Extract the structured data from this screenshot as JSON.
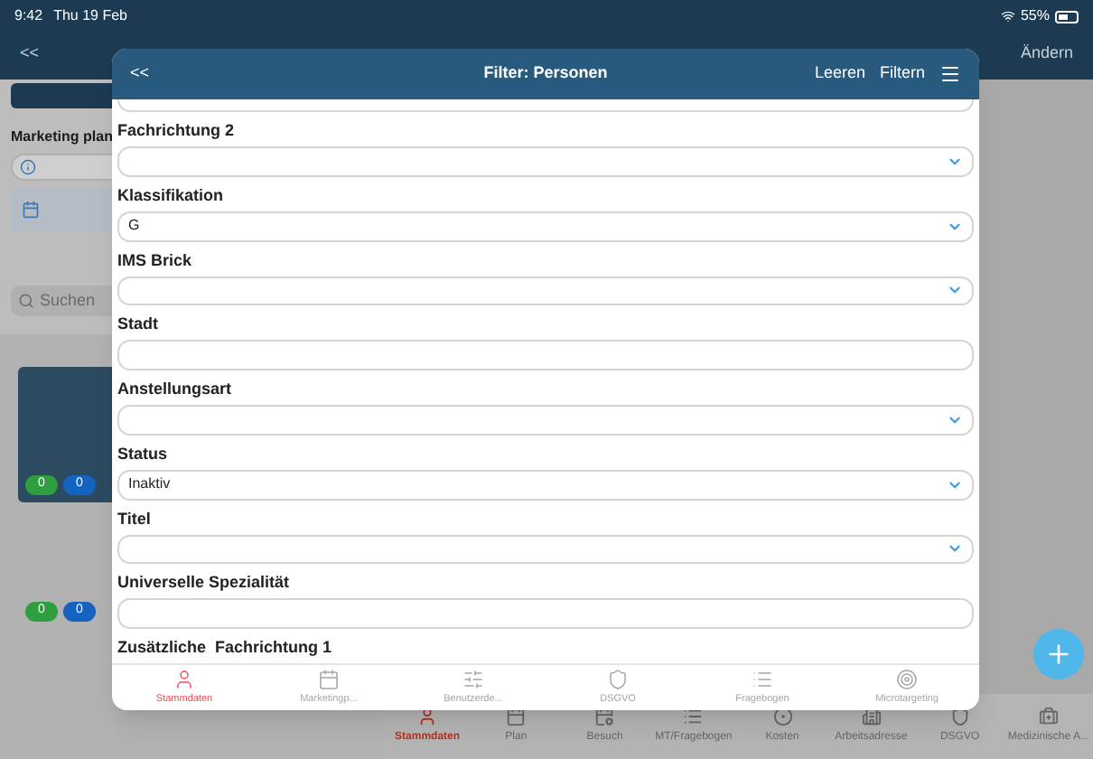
{
  "status_bar": {
    "time": "9:42",
    "date": "Thu 19 Feb",
    "battery": "55%"
  },
  "background": {
    "back": "<<",
    "edit": "Ändern",
    "section_label": "Marketing plan",
    "search": {
      "placeholder": "Suchen"
    },
    "badge_rows": [
      [
        {
          "text": "0",
          "color": "#2e9e3e"
        },
        {
          "text": "0",
          "color": "#1463c0"
        }
      ],
      [
        {
          "text": "0",
          "color": "#2e9e3e"
        },
        {
          "text": "0",
          "color": "#1463c0"
        }
      ]
    ],
    "tabs": [
      {
        "label": "Stammdaten",
        "selected": true
      },
      {
        "label": "Plan",
        "selected": false
      },
      {
        "label": "Besuch",
        "selected": false
      },
      {
        "label": "MT/Fragebogen",
        "selected": false
      },
      {
        "label": "Kosten",
        "selected": false
      },
      {
        "label": "Arbeitsadresse",
        "selected": false
      },
      {
        "label": "DSGVO",
        "selected": false
      },
      {
        "label": "Medizinische A...",
        "selected": false
      }
    ]
  },
  "dialog": {
    "back": "<<",
    "title": "Filter: Personen",
    "actions": [
      "Leeren",
      "Filtern"
    ],
    "fields": [
      {
        "label": "Fachrichtung 2",
        "kind": "select"
      },
      {
        "label": "Klassifikation",
        "kind": "select",
        "value": "G"
      },
      {
        "label": "IMS Brick",
        "kind": "select"
      },
      {
        "label": "Stadt",
        "kind": "text"
      },
      {
        "label": "Anstellungsart",
        "kind": "select"
      },
      {
        "label": "Status",
        "kind": "select",
        "value": "Inaktiv"
      },
      {
        "label": "Titel",
        "kind": "select"
      },
      {
        "label": "Universelle Spezialität",
        "kind": "text"
      },
      {
        "label": "Zusätzliche  Fachrichtung 1",
        "kind": "label"
      }
    ],
    "tabs": [
      {
        "label": "Stammdaten",
        "selected": true
      },
      {
        "label": "Marketingp...",
        "selected": false
      },
      {
        "label": "Benutzerde...",
        "selected": false
      },
      {
        "label": "DSGVO",
        "selected": false
      },
      {
        "label": "Fragebogen",
        "selected": false
      },
      {
        "label": "Microtargeting",
        "selected": false
      }
    ]
  }
}
